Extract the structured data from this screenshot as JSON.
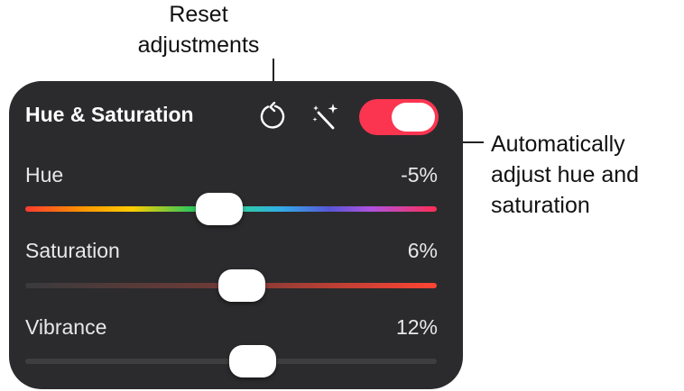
{
  "callouts": {
    "reset": "Reset\nadjustments",
    "auto": "Automatically\nadjust hue and\nsaturation"
  },
  "panel": {
    "title": "Hue & Saturation",
    "reset_icon": "reset-circular-arrow-icon",
    "auto_icon": "magic-wand-icon",
    "toggle_on": true,
    "toggle_color": "#fb3550"
  },
  "sliders": [
    {
      "label": "Hue",
      "value": "-5%",
      "position": 0.475
    },
    {
      "label": "Saturation",
      "value": "6%",
      "position": 0.53
    },
    {
      "label": "Vibrance",
      "value": "12%",
      "position": 0.56
    }
  ]
}
